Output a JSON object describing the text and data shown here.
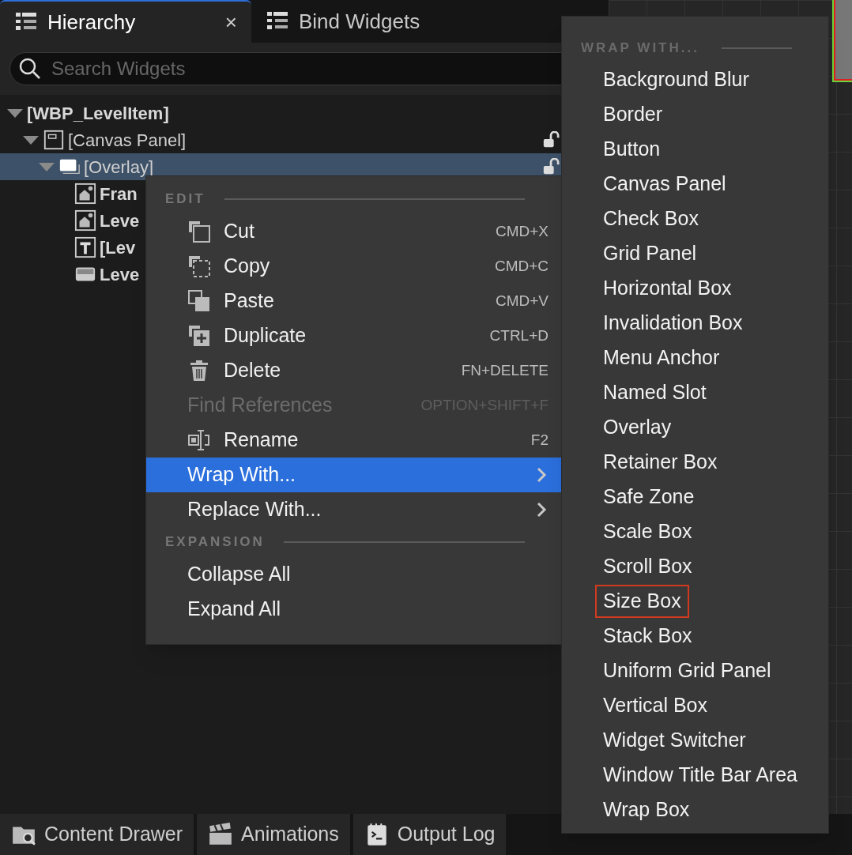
{
  "tabs": [
    {
      "label": "Hierarchy",
      "selected": true,
      "close": "×"
    },
    {
      "label": "Bind Widgets",
      "selected": false
    }
  ],
  "search": {
    "placeholder": "Search Widgets"
  },
  "tree": [
    {
      "label": "[WBP_LevelItem]",
      "expanded": true,
      "selected": false,
      "children": [
        {
          "label": "[Canvas Panel]",
          "kind": "canvas",
          "expanded": true,
          "selected": false,
          "lock": true,
          "children": [
            {
              "label": "[Overlay]",
              "kind": "overlay",
              "expanded": true,
              "selected": true,
              "lock": true,
              "children": [
                {
                  "label": "Fran",
                  "kind": "image"
                },
                {
                  "label": "Leve",
                  "kind": "image"
                },
                {
                  "label": "[Lev",
                  "kind": "text"
                },
                {
                  "label": "Leve",
                  "kind": "bar"
                }
              ]
            }
          ]
        }
      ]
    }
  ],
  "context_menu": {
    "sections": [
      {
        "title": "EDIT",
        "items": [
          {
            "label": "Cut",
            "kind": "cut",
            "shortcut": "CMD+X",
            "disabled": false,
            "selected": false
          },
          {
            "label": "Copy",
            "kind": "copy",
            "shortcut": "CMD+C",
            "disabled": false,
            "selected": false
          },
          {
            "label": "Paste",
            "kind": "paste",
            "shortcut": "CMD+V",
            "disabled": false,
            "selected": false
          },
          {
            "label": "Duplicate",
            "kind": "duplicate",
            "shortcut": "CTRL+D",
            "disabled": false,
            "selected": false
          },
          {
            "label": "Delete",
            "kind": "delete",
            "shortcut": "FN+DELETE",
            "disabled": false,
            "selected": false
          },
          {
            "label": "Find References",
            "kind": "plain",
            "shortcut": "OPTION+SHIFT+F",
            "disabled": true,
            "selected": false
          },
          {
            "label": "Rename",
            "kind": "rename",
            "shortcut": "F2",
            "disabled": false,
            "selected": false
          },
          {
            "label": "Wrap With...",
            "kind": "submenu",
            "disabled": false,
            "selected": true
          },
          {
            "label": "Replace With...",
            "kind": "submenu",
            "disabled": false,
            "selected": false
          }
        ]
      },
      {
        "title": "EXPANSION",
        "items": [
          {
            "label": "Collapse All",
            "kind": "plain",
            "disabled": false,
            "selected": false
          },
          {
            "label": "Expand All",
            "kind": "plain",
            "disabled": false,
            "selected": false
          }
        ]
      }
    ]
  },
  "submenu": {
    "title": "WRAP WITH...",
    "items": [
      {
        "label": "Background Blur",
        "highlighted": false
      },
      {
        "label": "Border",
        "highlighted": false
      },
      {
        "label": "Button",
        "highlighted": false
      },
      {
        "label": "Canvas Panel",
        "highlighted": false
      },
      {
        "label": "Check Box",
        "highlighted": false
      },
      {
        "label": "Grid Panel",
        "highlighted": false
      },
      {
        "label": "Horizontal Box",
        "highlighted": false
      },
      {
        "label": "Invalidation Box",
        "highlighted": false
      },
      {
        "label": "Menu Anchor",
        "highlighted": false
      },
      {
        "label": "Named Slot",
        "highlighted": false
      },
      {
        "label": "Overlay",
        "highlighted": false
      },
      {
        "label": "Retainer Box",
        "highlighted": false
      },
      {
        "label": "Safe Zone",
        "highlighted": false
      },
      {
        "label": "Scale Box",
        "highlighted": false
      },
      {
        "label": "Scroll Box",
        "highlighted": false
      },
      {
        "label": "Size Box",
        "highlighted": true
      },
      {
        "label": "Stack Box",
        "highlighted": false
      },
      {
        "label": "Uniform Grid Panel",
        "highlighted": false
      },
      {
        "label": "Vertical Box",
        "highlighted": false
      },
      {
        "label": "Widget Switcher",
        "highlighted": false
      },
      {
        "label": "Window Title Bar Area",
        "highlighted": false
      },
      {
        "label": "Wrap Box",
        "highlighted": false
      }
    ]
  },
  "bottom_tabs": [
    {
      "label": "Content Drawer",
      "kind": "folder"
    },
    {
      "label": "Animations",
      "kind": "clapper"
    },
    {
      "label": "Output Log",
      "kind": "log"
    }
  ]
}
